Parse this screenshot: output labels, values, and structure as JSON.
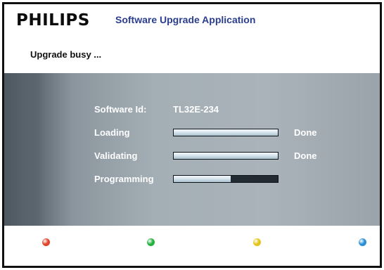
{
  "header": {
    "brand": "PHILIPS",
    "app_title": "Software Upgrade Application"
  },
  "status_text": "Upgrade busy ...",
  "details": {
    "software_id_label": "Software Id:",
    "software_id_value": "TL32E-234",
    "steps": [
      {
        "label": "Loading",
        "progress": 1.0,
        "status": "Done"
      },
      {
        "label": "Validating",
        "progress": 1.0,
        "status": "Done"
      },
      {
        "label": "Programming",
        "progress": 0.55,
        "status": ""
      }
    ]
  },
  "color_keys": [
    {
      "name": "red",
      "color": "#e0442a"
    },
    {
      "name": "green",
      "color": "#25b23e"
    },
    {
      "name": "yellow",
      "color": "#e3c51a"
    },
    {
      "name": "blue",
      "color": "#2a8fd6"
    }
  ]
}
